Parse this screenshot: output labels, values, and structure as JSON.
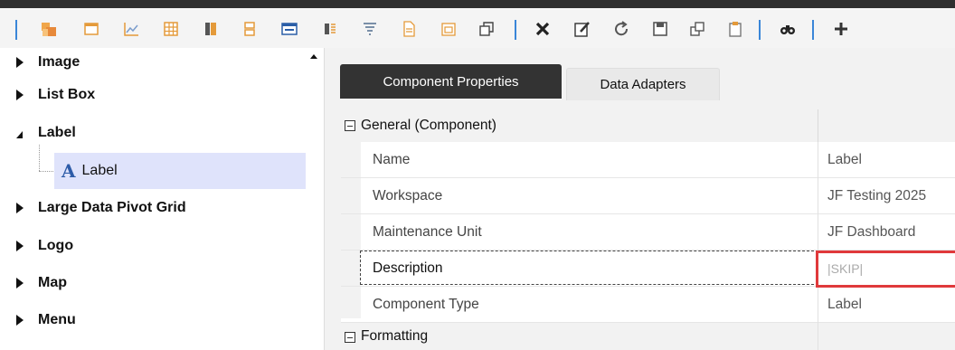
{
  "toolbar": {
    "icons": [
      "component-icon",
      "window-icon",
      "line-chart-icon",
      "grid-icon",
      "bar-icon",
      "layout-icon",
      "form-icon",
      "list-icon",
      "filter-icon",
      "document-icon",
      "calendar-icon",
      "copy-icon",
      "delete-icon",
      "edit-icon",
      "refresh-icon",
      "save-icon",
      "window-restore-icon",
      "clipboard-icon",
      "binoculars-icon",
      "add-icon"
    ]
  },
  "tree": {
    "items": [
      {
        "label": "Image",
        "state": "collapsed"
      },
      {
        "label": "List Box",
        "state": "collapsed"
      },
      {
        "label": "Label",
        "state": "expanded"
      },
      {
        "label": "Large Data Pivot Grid",
        "state": "collapsed"
      },
      {
        "label": "Logo",
        "state": "collapsed"
      },
      {
        "label": "Map",
        "state": "collapsed"
      },
      {
        "label": "Menu",
        "state": "collapsed"
      }
    ],
    "selected_child": {
      "icon_glyph": "A",
      "label": "Label"
    }
  },
  "tabs": {
    "active": "Component Properties",
    "inactive": "Data Adapters"
  },
  "properties": {
    "general_header": "General (Component)",
    "rows": [
      {
        "name": "Name",
        "value": "Label"
      },
      {
        "name": "Workspace",
        "value": "JF Testing 2025"
      },
      {
        "name": "Maintenance Unit",
        "value": "JF Dashboard"
      },
      {
        "name": "Description",
        "value": "|SKIP|"
      },
      {
        "name": "Component Type",
        "value": "Label"
      }
    ],
    "formatting_header": "Formatting"
  },
  "colors": {
    "accent_blue": "#3a86d8",
    "highlight_red": "#e0393b",
    "selected_bg": "#dfe3fb",
    "tab_active_bg": "#333333"
  }
}
